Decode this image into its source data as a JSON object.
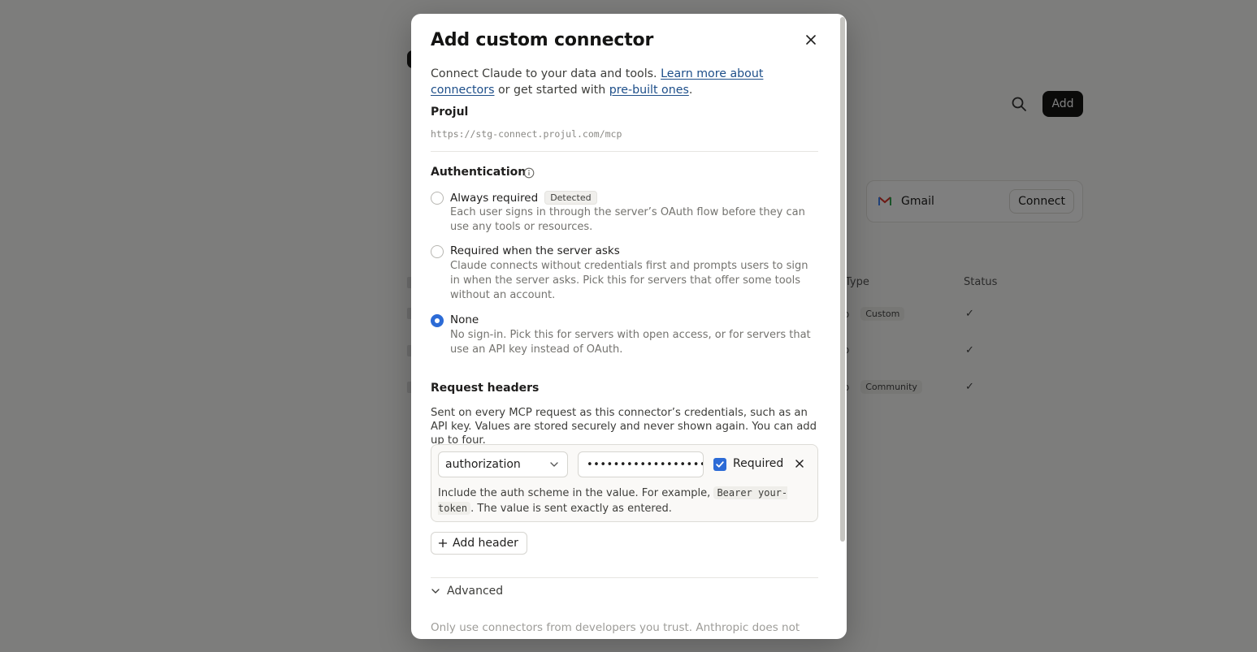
{
  "background": {
    "add_button": "Add",
    "gmail_card": {
      "label": "Gmail",
      "button": "Connect"
    },
    "columns": {
      "type": "Type",
      "status": "Status"
    },
    "rows": [
      {
        "tag": "Custom"
      },
      {
        "tag": ""
      },
      {
        "tag": "Community"
      }
    ]
  },
  "modal": {
    "title": "Add custom connector",
    "close_icon": "close-icon",
    "intro": {
      "text_1": "Connect Claude to your data and tools. ",
      "link_1": "Learn more about connectors",
      "text_2": " or get started with ",
      "link_2": "pre-built ones",
      "text_3": "."
    },
    "connector": {
      "name": "Projul",
      "url": "https://stg-connect.projul.com/mcp"
    },
    "authentication": {
      "label": "Authentication",
      "info_icon": "info-icon",
      "options": [
        {
          "title": "Always required",
          "badge": "Detected",
          "description": "Each user signs in through the server’s OAuth flow before they can use any tools or resources.",
          "checked": false
        },
        {
          "title": "Required when the server asks",
          "badge": "",
          "description": "Claude connects without credentials first and prompts users to sign in when the server asks. Pick this for servers that offer some tools without an account.",
          "checked": false
        },
        {
          "title": "None",
          "badge": "",
          "description": "No sign-in. Pick this for servers with open access, or for servers that use an API key instead of OAuth.",
          "checked": true
        }
      ]
    },
    "request_headers": {
      "label": "Request headers",
      "description": "Sent on every MCP request as this connector’s credentials, such as an API key. Values are stored securely and never shown again. You can add up to four.",
      "header": {
        "name": "authorization",
        "value": "••••••••••••••••••••",
        "required_label": "Required",
        "required_checked": true
      },
      "hint_1": "Include the auth scheme in the value. For example, ",
      "hint_code": "Bearer your-token",
      "hint_2": ". The value is sent exactly as entered.",
      "add_button": "Add header"
    },
    "advanced_label": "Advanced",
    "footer_note": "Only use connectors from developers you trust. Anthropic does not"
  }
}
